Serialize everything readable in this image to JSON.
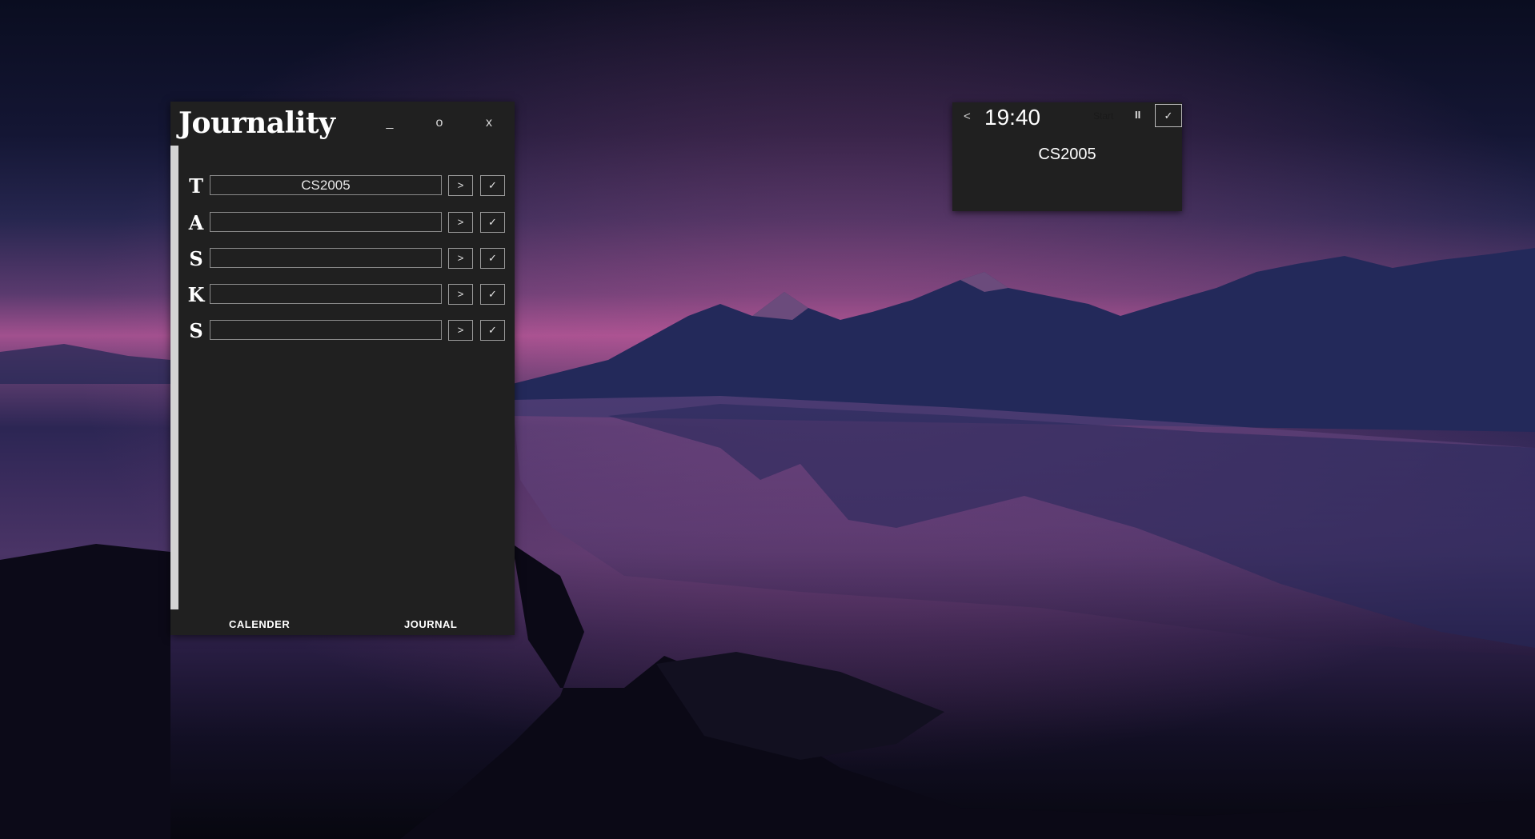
{
  "app": {
    "title": "Journality",
    "window_buttons": {
      "minimize": "_",
      "maximize": "o",
      "close": "x"
    },
    "tasks_letters": [
      "T",
      "A",
      "S",
      "K",
      "S"
    ],
    "tasks": [
      {
        "value": "CS2005",
        "go_label": ">",
        "done_label": "✓"
      },
      {
        "value": "",
        "go_label": ">",
        "done_label": "✓"
      },
      {
        "value": "",
        "go_label": ">",
        "done_label": "✓"
      },
      {
        "value": "",
        "go_label": ">",
        "done_label": "✓"
      },
      {
        "value": "",
        "go_label": ">",
        "done_label": "✓"
      }
    ],
    "nav": {
      "calendar": "CALENDER",
      "journal": "JOURNAL"
    }
  },
  "timer": {
    "back": "<",
    "time": "19:40",
    "start": "Start",
    "pause": "II",
    "check": "✓",
    "task": "CS2005"
  },
  "colors": {
    "window_bg": "#202020",
    "scroll_strip": "#d3d3d3",
    "text": "#ffffff",
    "border": "#8a8a8a"
  }
}
